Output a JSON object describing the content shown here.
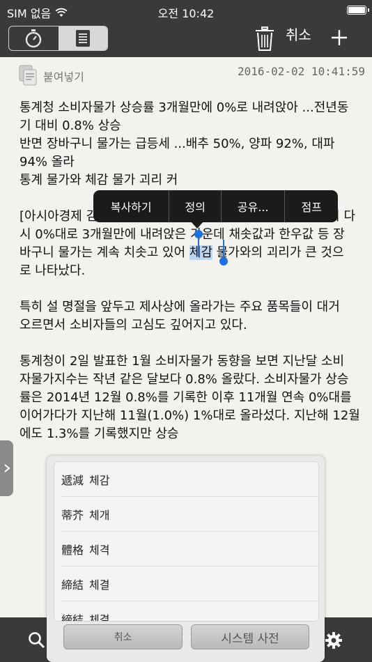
{
  "status": {
    "carrier": "SIM 없음",
    "time": "오전 10:42"
  },
  "toolbar": {
    "cancel_label": "취소"
  },
  "note": {
    "paste_label": "붙여넣기",
    "date": "2016-02-02 10:41:59",
    "lines": {
      "l1": "통계청 소비자물가 상승률 3개월만에 0%로 내려앉아 ...전년동",
      "l2": "기 대비 0.8% 상승",
      "l3": "반면 장바구니 물가는 급등세 ...배추 50%, 양파 92%, 대파",
      "l4": "94% 올라",
      "l5": "통계 물가와 체감 물가 괴리 커",
      "l6a": "[아시아경제 김",
      "l6b": "이 다",
      "l7": "시 0%대로 3개월만에 내려앉은 가운데 채솟값과 한우값 등 장",
      "l8a": "바구니 물가는 계속 치솟고 있어 ",
      "l8sel": "체감",
      "l8b": " 물가와의 괴리가 큰 것으",
      "l9": "로 나타났다.",
      "l10": "특히 설 명절을 앞두고 제사상에 올라가는 주요 품목들이 대거",
      "l11": "오르면서 소비자들의 고심도 깊어지고 있다.",
      "l12": "통계청이 2일 발표한 1월 소비자물가 동향을 보면 지난달 소비",
      "l13": "자물가지수는 작년 같은 달보다 0.8% 올랐다. 소비자물가 상승",
      "l14": "률은 2014년 12월 0.8%를 기록한 이후 11개월 연속 0%대를",
      "l15": "이어가다가 지난해 11월(1.0%) 1%대로 올라섰다. 지난해 12월",
      "l16": "에도 1.3%를 기록했지만 상승"
    }
  },
  "popup": {
    "items": [
      {
        "label": "복사하기"
      },
      {
        "label": "정의"
      },
      {
        "label": "공유..."
      },
      {
        "label": "점프"
      }
    ]
  },
  "dictionary": {
    "items": [
      {
        "hanja": "遞減",
        "hangul": "체감"
      },
      {
        "hanja": "蒂芥",
        "hangul": "체개"
      },
      {
        "hanja": "體格",
        "hangul": "체격"
      },
      {
        "hanja": "締結",
        "hangul": "체결"
      },
      {
        "hanja": "締結",
        "hangul": "체결"
      }
    ],
    "cancel_label": "취소",
    "system_label": "시스템 사전"
  }
}
